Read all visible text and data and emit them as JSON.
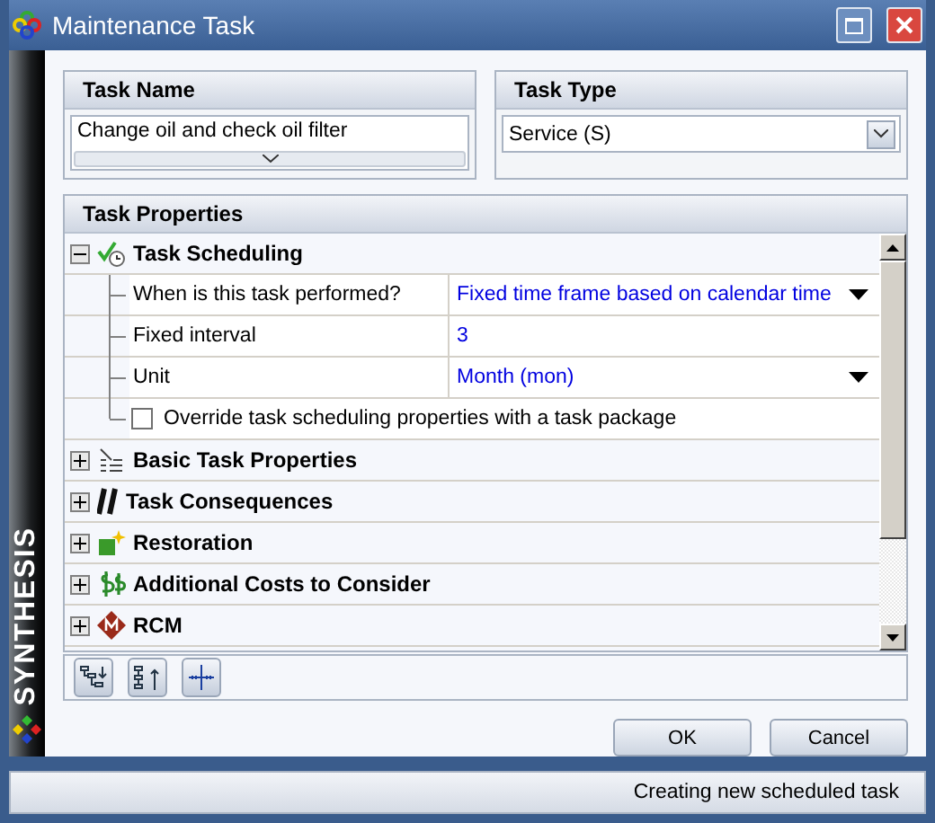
{
  "window": {
    "title": "Maintenance Task"
  },
  "brand": "SYNTHESIS",
  "task_name": {
    "header": "Task Name",
    "value": "Change oil and check oil filter"
  },
  "task_type": {
    "header": "Task Type",
    "value": "Service (S)"
  },
  "properties": {
    "header": "Task Properties",
    "groups": [
      {
        "label": "Task Scheduling",
        "expanded": true,
        "rows": [
          {
            "kind": "dropdown",
            "label": "When is this task performed?",
            "value": "Fixed time frame based on calendar time"
          },
          {
            "kind": "text",
            "label": "Fixed interval",
            "value": "3"
          },
          {
            "kind": "dropdown",
            "label": "Unit",
            "value": "Month (mon)"
          },
          {
            "kind": "checkbox",
            "label": "Override task scheduling properties with a task package",
            "checked": false
          }
        ]
      },
      {
        "label": "Basic Task Properties",
        "expanded": false
      },
      {
        "label": "Task Consequences",
        "expanded": false
      },
      {
        "label": "Restoration",
        "expanded": false
      },
      {
        "label": "Additional Costs to Consider",
        "expanded": false
      },
      {
        "label": "RCM",
        "expanded": false
      }
    ]
  },
  "buttons": [
    "OK",
    "Cancel"
  ],
  "status_bar": "Creating new scheduled task"
}
